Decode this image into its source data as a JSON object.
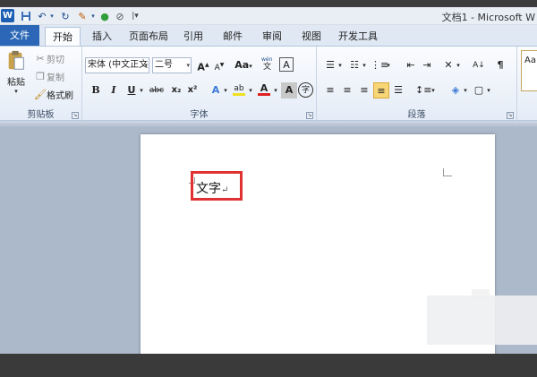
{
  "window": {
    "title": "文档1 - Microsoft W"
  },
  "quick_access": {
    "word_logo": "W",
    "save_icon": "save-icon",
    "undo_icon": "undo-icon",
    "redo_icon": "redo-icon",
    "customize_icon": "customize-icon"
  },
  "tabs": [
    "文件",
    "开始",
    "插入",
    "页面布局",
    "引用",
    "邮件",
    "审阅",
    "视图",
    "开发工具"
  ],
  "active_tab": "开始",
  "ribbon": {
    "clipboard": {
      "label": "剪贴板",
      "paste": "粘贴",
      "cut": "剪切",
      "copy": "复制",
      "format_painter": "格式刷"
    },
    "font": {
      "label": "字体",
      "font_name": "宋体 (中文正文",
      "font_size": "二号",
      "grow": "A",
      "shrink": "A",
      "change_case": "Aa",
      "clear_format": "A",
      "bold": "B",
      "italic": "I",
      "underline": "U",
      "strikethrough": "abc",
      "subscript": "x₂",
      "superscript": "x²",
      "text_effect": "A",
      "highlight": "ab",
      "font_color": "A",
      "char_shading": "A",
      "enclose_char": "字"
    },
    "paragraph": {
      "label": "段落"
    },
    "styles": {
      "preview": "Aa"
    }
  },
  "document": {
    "text": "文字",
    "paragraph_mark": "↵"
  },
  "colors": {
    "file_tab": "#2b67b6",
    "highlight_box": "#e03232",
    "workspace": "#abb9cb",
    "font_color_bar": "#e02020",
    "highlight_color_bar": "#f0e020"
  }
}
